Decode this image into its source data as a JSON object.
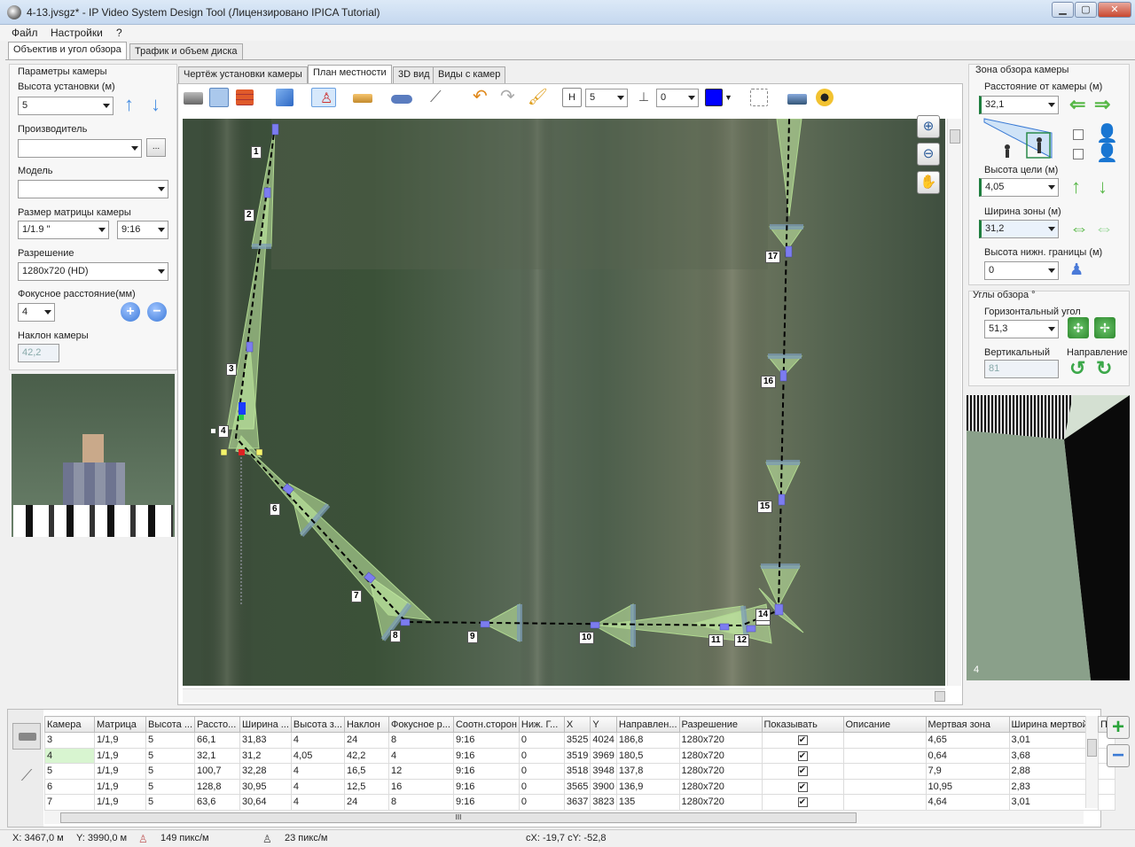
{
  "window": {
    "title": "4-13.jvsgz* - IP Video System Design Tool (Лицензировано  IPICA Tutorial)",
    "min": "▁",
    "max": "▢",
    "close": "✕"
  },
  "menu": [
    "Файл",
    "Настройки",
    "?"
  ],
  "main_tabs": [
    "Объектив и угол обзора",
    "Трафик и объем диска"
  ],
  "left_panel": {
    "section_title": "Параметры камеры",
    "height_label": "Высота установки (м)",
    "height_value": "5",
    "manufacturer_label": "Производитель",
    "manufacturer_value": "",
    "more_btn": "...",
    "model_label": "Модель",
    "model_value": "",
    "sensor_label": "Размер матрицы камеры",
    "sensor_value": "1/1.9 \"",
    "aspect_value": "9:16",
    "resolution_label": "Разрешение",
    "resolution_value": "1280x720 (HD)",
    "focal_label": "Фокусное расстояние(мм)",
    "focal_value": "4",
    "tilt_label": "Наклон камеры",
    "tilt_value": "42,2"
  },
  "view_tabs": [
    "Чертёж установки камеры",
    "План местности",
    "3D вид",
    "Виды с камер"
  ],
  "toolbar": {
    "height_value": "5",
    "offset_value": "0",
    "color": "#0000ff"
  },
  "cameras": [
    {
      "id": "1"
    },
    {
      "id": "2"
    },
    {
      "id": "3"
    },
    {
      "id": "4"
    },
    {
      "id": "6"
    },
    {
      "id": "7"
    },
    {
      "id": "8"
    },
    {
      "id": "9"
    },
    {
      "id": "10"
    },
    {
      "id": "11"
    },
    {
      "id": "12"
    },
    {
      "id": "13"
    },
    {
      "id": "14"
    },
    {
      "id": "15"
    },
    {
      "id": "16"
    },
    {
      "id": "17"
    }
  ],
  "right_panel": {
    "zone_title": "Зона обзора камеры",
    "distance_label": "Расстояние от камеры (м)",
    "distance_value": "32,1",
    "target_height_label": "Высота цели (м)",
    "target_height_value": "4,05",
    "zone_width_label": "Ширина зоны (м)",
    "zone_width_value": "31,2",
    "lower_bound_label": "Высота нижн. границы (м)",
    "lower_bound_value": "0",
    "angles_title": "Углы обзора °",
    "h_angle_label": "Горизонтальный угол",
    "h_angle_value": "51,3",
    "v_angle_label": "Вертикальный",
    "direction_label": "Направление",
    "v_angle_value": "81",
    "preview_cam": "4"
  },
  "table": {
    "headers": [
      "Камера",
      "Матрица",
      "Высота ...",
      "Рассто...",
      "Ширина ...",
      "Высота з...",
      "Наклон",
      "Фокусное р...",
      "Соотн.сторон",
      "Ниж. Г...",
      "X",
      "Y",
      "Направлен...",
      "Разрешение",
      "Показывать",
      "Описание",
      "Мертвая зона",
      "Ширина мертвой...",
      "Пр"
    ],
    "rows": [
      [
        "3",
        "1/1,9",
        "5",
        "66,1",
        "31,83",
        "4",
        "24",
        "8",
        "9:16",
        "0",
        "3525",
        "4024",
        "186,8",
        "1280x720",
        "✔",
        "",
        "4,65",
        "3,01",
        ""
      ],
      [
        "4",
        "1/1,9",
        "5",
        "32,1",
        "31,2",
        "4,05",
        "42,2",
        "4",
        "9:16",
        "0",
        "3519",
        "3969",
        "180,5",
        "1280x720",
        "✔",
        "",
        "0,64",
        "3,68",
        ""
      ],
      [
        "5",
        "1/1,9",
        "5",
        "100,7",
        "32,28",
        "4",
        "16,5",
        "12",
        "9:16",
        "0",
        "3518",
        "3948",
        "137,8",
        "1280x720",
        "✔",
        "",
        "7,9",
        "2,88",
        ""
      ],
      [
        "6",
        "1/1,9",
        "5",
        "128,8",
        "30,95",
        "4",
        "12,5",
        "16",
        "9:16",
        "0",
        "3565",
        "3900",
        "136,9",
        "1280x720",
        "✔",
        "",
        "10,95",
        "2,83",
        ""
      ],
      [
        "7",
        "1/1,9",
        "5",
        "63,6",
        "30,64",
        "4",
        "24",
        "8",
        "9:16",
        "0",
        "3637",
        "3823",
        "135",
        "1280x720",
        "✔",
        "",
        "4,64",
        "3,01",
        ""
      ]
    ],
    "scroll_mark": "III"
  },
  "status": {
    "x": "X: 3467,0 м",
    "y": "Y: 3990,0 м",
    "ppm1": "149 пикс/м",
    "ppm2": "23 пикс/м",
    "cxy": "cX: -19,7 cY: -52,8"
  }
}
